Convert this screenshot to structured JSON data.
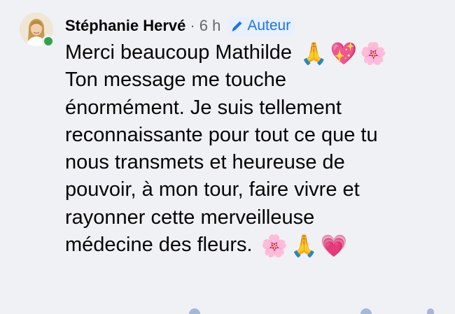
{
  "comment": {
    "author_name": "Stéphanie Hervé",
    "separator": "·",
    "timestamp": "6 h",
    "badge_label": "Auteur",
    "line_1": "Merci beaucoup Mathilde",
    "line_1_emojis": [
      "🙏",
      "💖",
      "🌸"
    ],
    "body": "\nTon message me touche\nénormément. Je suis tellement\nreconnaissante pour tout ce que tu\nnous transmets et heureuse de\npouvoir, à mon tour, faire vivre et\nrayonner cette merveilleuse\nmédecine des fleurs.",
    "body_emojis": [
      "🌸",
      "🙏",
      "💗"
    ]
  },
  "icons": {
    "avatar": "profile-photo",
    "online": "online-status-dot",
    "badge": "pencil-icon"
  },
  "colors": {
    "background": "#f0f1f5",
    "badge_text": "#1b74e4",
    "badge_background": "#e7f0fc",
    "online": "#31a24c",
    "secondary_text": "#65676b"
  }
}
